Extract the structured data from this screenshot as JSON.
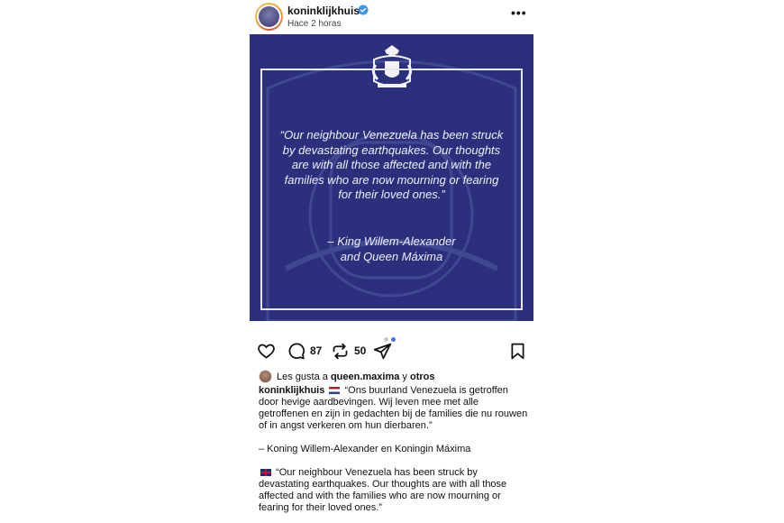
{
  "header": {
    "username": "koninklijkhuis",
    "time": "Hace 2 horas",
    "more": "•••",
    "icons": {
      "avatar": "royal-house-avatar",
      "verified": "verified-badge-icon",
      "more": "more-options-icon"
    }
  },
  "image": {
    "quote": "“Our neighbour Venezuela has been struck by devastating earthquakes. Our thoughts are with all those affected and with the families who are now mourning or fearing for their loved ones.”",
    "signature_line1": "– King Willem-Alexander",
    "signature_line2": "and Queen Máxima",
    "colors": {
      "background": "#2b2f7c",
      "frame": "#e8e8f2",
      "text": "#eef0f8"
    },
    "carousel": {
      "current": 2,
      "total": 2
    }
  },
  "actions": {
    "comments": "87",
    "reposts": "50",
    "icons": [
      "heart-icon",
      "comment-icon",
      "repost-icon",
      "share-icon",
      "bookmark-icon"
    ]
  },
  "likes": {
    "prefix": "Les gusta a",
    "user": "queen.maxima",
    "connector": "y",
    "others": "otros"
  },
  "caption": {
    "username": "koninklijkhuis",
    "dutch": "“Ons buurland Venezuela is getroffen door hevige aardbevingen. Wij leven mee met alle getroffenen en zijn in gedachten bij de families die nu rouwen of in angst verkeren om hun dierbaren.”",
    "dutch_signature": "– Koning Willem-Alexander en Koningin Máxima",
    "english": "“Our neighbour Venezuela has been struck by devastating earthquakes. Our thoughts are with all those affected and with the families who are now mourning or fearing for their loved ones.”"
  }
}
